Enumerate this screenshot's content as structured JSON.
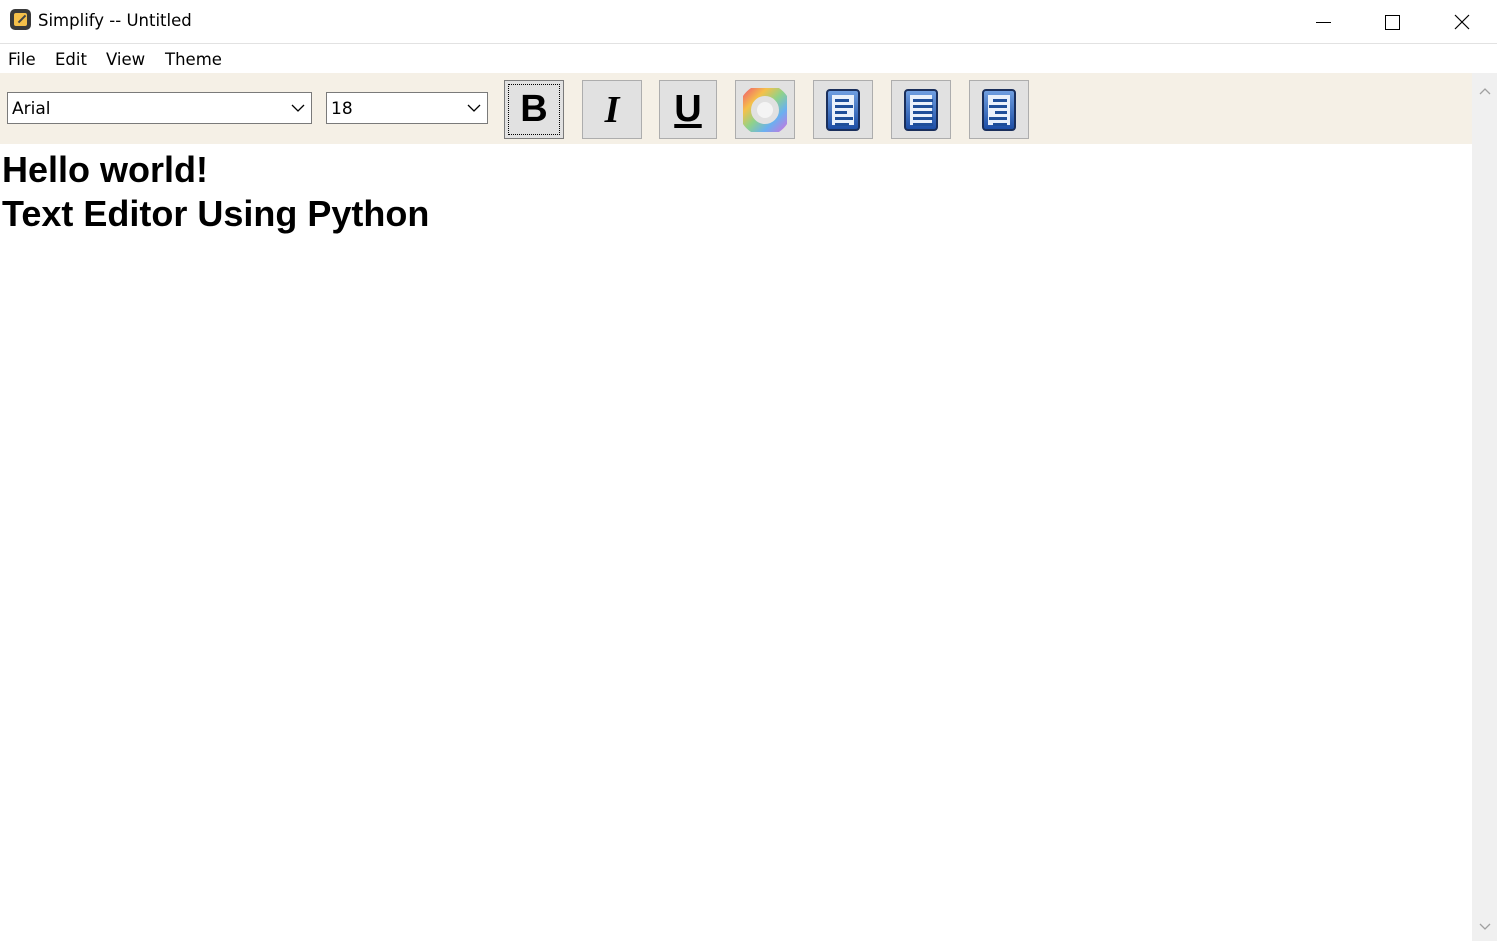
{
  "window": {
    "title": "Simplify -- Untitled",
    "icon": "notepad-app-icon",
    "controls": [
      "minimize-icon",
      "maximize-icon",
      "close-icon"
    ]
  },
  "menu": {
    "items": [
      "File",
      "Edit",
      "View",
      "Theme"
    ]
  },
  "toolbar": {
    "font_family": "Arial",
    "font_size": "18",
    "buttons": [
      {
        "label": "B",
        "icon": "bold-icon",
        "focused": true
      },
      {
        "label": "I",
        "icon": "italic-icon"
      },
      {
        "label": "U",
        "icon": "underline-icon"
      },
      {
        "icon": "color-wheel-icon"
      },
      {
        "icon": "align-left-icon"
      },
      {
        "icon": "align-center-icon"
      },
      {
        "icon": "align-right-icon"
      }
    ]
  },
  "editor": {
    "lines": [
      "Hello world!",
      "Text Editor Using Python"
    ]
  },
  "colors": {
    "toolbar_bg": "#f5f0e6",
    "button_bg": "#e1e1e1",
    "align_icon_blue": "#1e4fa6"
  }
}
